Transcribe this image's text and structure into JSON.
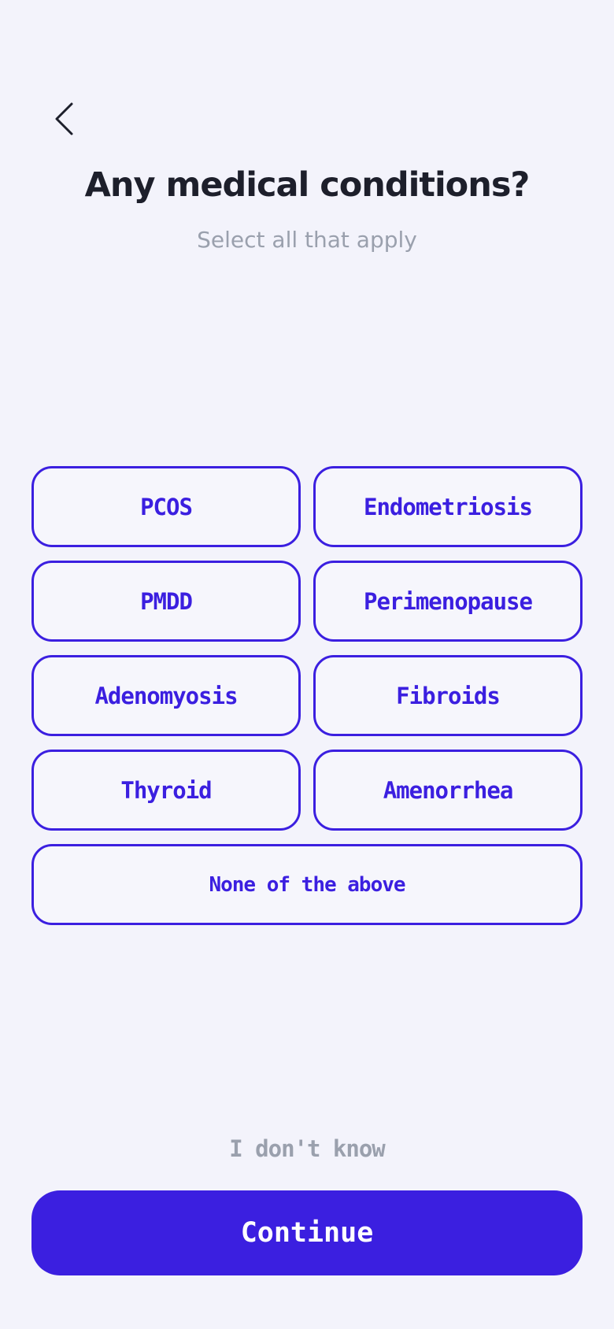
{
  "header": {
    "back_icon": "chevron-left-icon",
    "title": "Any medical conditions?",
    "subtitle": "Select all that apply"
  },
  "options": [
    {
      "label": "PCOS",
      "selected": false
    },
    {
      "label": "Endometriosis",
      "selected": false
    },
    {
      "label": "PMDD",
      "selected": false
    },
    {
      "label": "Perimenopause",
      "selected": false
    },
    {
      "label": "Adenomyosis",
      "selected": false
    },
    {
      "label": "Fibroids",
      "selected": false
    },
    {
      "label": "Thyroid",
      "selected": false
    },
    {
      "label": "Amenorrhea",
      "selected": false
    },
    {
      "label": "None of the above",
      "selected": false
    }
  ],
  "footer": {
    "dont_know_label": "I don't know",
    "continue_label": "Continue"
  },
  "colors": {
    "accent": "#3b1fe0",
    "background": "#f3f3fb",
    "title_text": "#1d1f2b",
    "muted_text": "#9aa0ad"
  }
}
